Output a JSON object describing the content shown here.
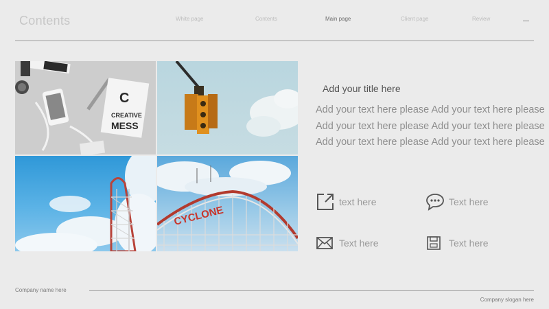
{
  "header": {
    "title": "Contents",
    "nav": [
      {
        "label": "White page",
        "active": false
      },
      {
        "label": "Contents",
        "active": false
      },
      {
        "label": "Main page",
        "active": true
      },
      {
        "label": "Client page",
        "active": false
      },
      {
        "label": "Review",
        "active": false
      }
    ]
  },
  "images": [
    {
      "name": "creative-mess-desk-photo",
      "text": "C CREATIVE MESS"
    },
    {
      "name": "traffic-light-photo"
    },
    {
      "name": "roller-coaster-tower-photo"
    },
    {
      "name": "cyclone-roller-coaster-photo",
      "text": "CYCLONE"
    }
  ],
  "content": {
    "subtitle": "Add your title here",
    "body": "Add your text here please Add your text here please Add your text here please Add your text here please Add your text here please Add your text here please",
    "features": [
      {
        "icon": "share-icon",
        "label": "text here"
      },
      {
        "icon": "chat-icon",
        "label": "Text here"
      },
      {
        "icon": "mail-icon",
        "label": "Text here"
      },
      {
        "icon": "save-icon",
        "label": "Text here"
      }
    ]
  },
  "footer": {
    "company_name": "Company name here",
    "company_slogan": "Company slogan here"
  },
  "colors": {
    "background": "#ebebeb",
    "line": "#9a9a9a",
    "icon": "#555555"
  }
}
